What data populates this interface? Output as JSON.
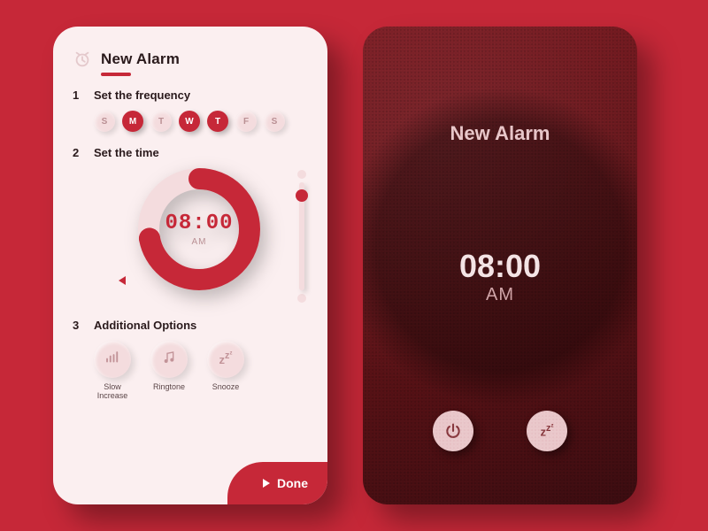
{
  "colors": {
    "accent": "#c62838",
    "surface": "#fbeff0",
    "pill": "#f4dcde"
  },
  "left": {
    "title": "New Alarm",
    "steps": {
      "s1": {
        "num": "1",
        "label": "Set the frequency"
      },
      "s2": {
        "num": "2",
        "label": "Set the time"
      },
      "s3": {
        "num": "3",
        "label": "Additional Options"
      }
    },
    "days": [
      {
        "letter": "S",
        "selected": false
      },
      {
        "letter": "M",
        "selected": true
      },
      {
        "letter": "T",
        "selected": false
      },
      {
        "letter": "W",
        "selected": true
      },
      {
        "letter": "T",
        "selected": true
      },
      {
        "letter": "F",
        "selected": false
      },
      {
        "letter": "S",
        "selected": false
      }
    ],
    "time": {
      "value": "08:00",
      "ampm": "AM",
      "progress_pct": 72
    },
    "options": [
      {
        "icon": "bars-icon",
        "label": "Slow\nIncrease"
      },
      {
        "icon": "note-icon",
        "label": "Ringtone"
      },
      {
        "icon": "zzz-icon",
        "label": "Snooze"
      }
    ],
    "done_label": "Done"
  },
  "right": {
    "title": "New Alarm",
    "time": "08:00",
    "ampm": "AM",
    "buttons": {
      "dismiss": "power-icon",
      "snooze": "zzz-icon"
    }
  }
}
